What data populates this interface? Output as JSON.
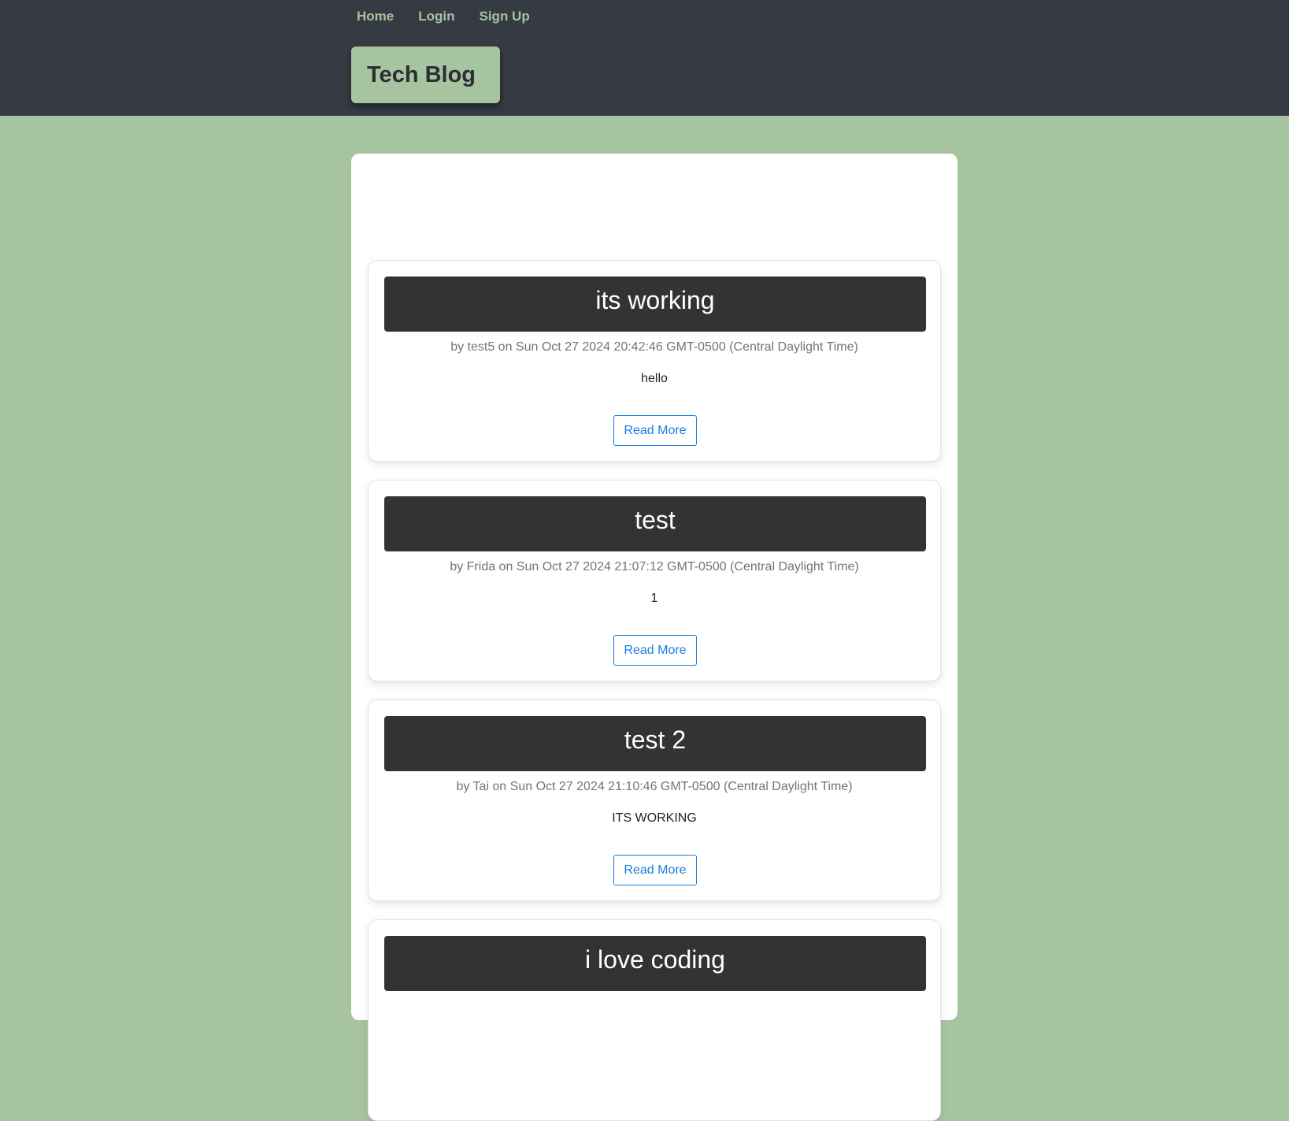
{
  "nav": {
    "items": [
      {
        "label": "Home"
      },
      {
        "label": "Login"
      },
      {
        "label": "Sign Up"
      }
    ]
  },
  "brand": {
    "title": "Tech Blog"
  },
  "posts": [
    {
      "title": "its working",
      "meta": "by test5 on Sun Oct 27 2024 20:42:46 GMT-0500 (Central Daylight Time)",
      "body": "hello",
      "button": "Read More"
    },
    {
      "title": "test",
      "meta": "by Frida on Sun Oct 27 2024 21:07:12 GMT-0500 (Central Daylight Time)",
      "body": "1",
      "button": "Read More"
    },
    {
      "title": "test 2",
      "meta": "by Tai on Sun Oct 27 2024 21:10:46 GMT-0500 (Central Daylight Time)",
      "body": "ITS WORKING",
      "button": "Read More"
    },
    {
      "title": "i love coding"
    }
  ],
  "colors": {
    "header_bg": "#363a43",
    "page_bg": "#a7c4a0",
    "accent": "#1a7ee0",
    "title_bar": "#333333"
  }
}
